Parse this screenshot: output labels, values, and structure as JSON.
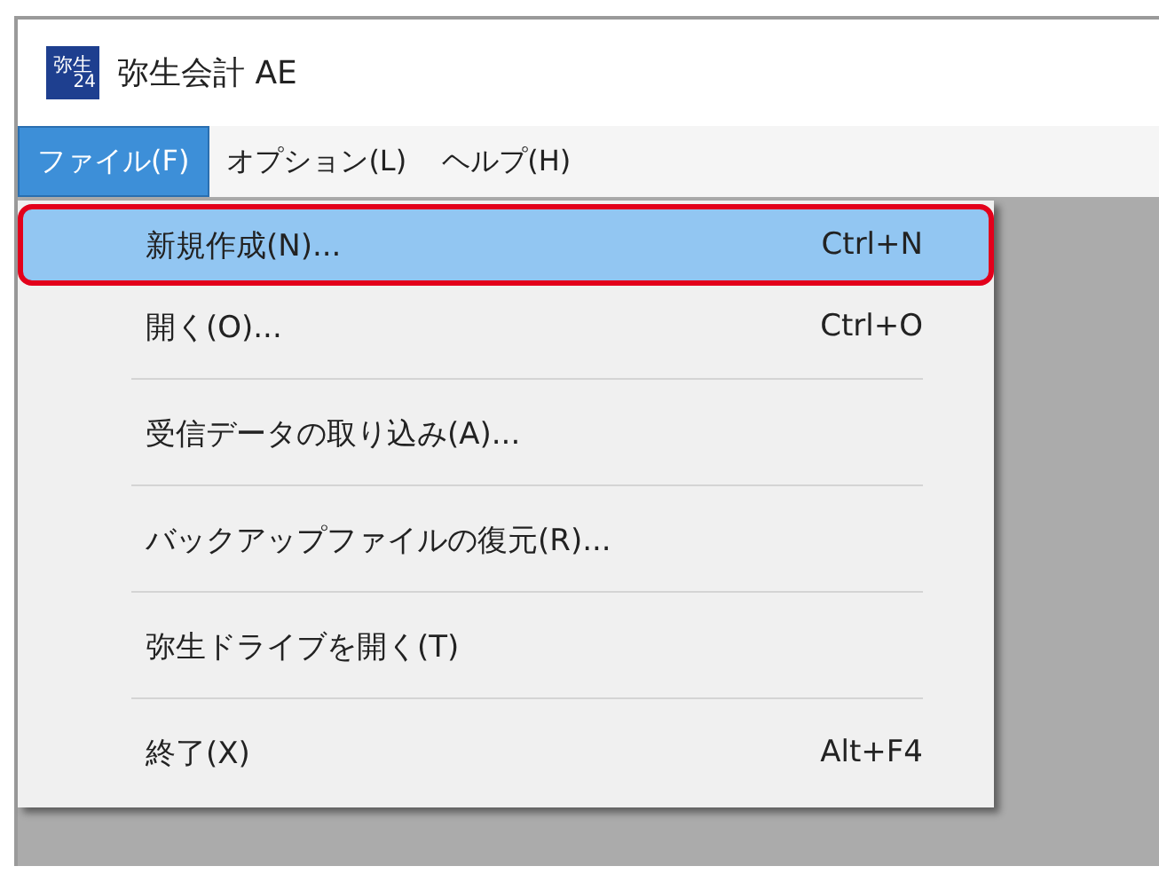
{
  "window": {
    "title": "弥生会計 AE",
    "app_icon": {
      "text": "弥生",
      "subtext": "24"
    }
  },
  "menu_bar": [
    {
      "label": "ファイル(F)",
      "selected": true
    },
    {
      "label": "オプション(L)",
      "selected": false
    },
    {
      "label": "ヘルプ(H)",
      "selected": false
    }
  ],
  "menu": [
    {
      "kind": "item",
      "label": "新規作成(N)...",
      "shortcut": "Ctrl+N",
      "selected": true,
      "outlined": true
    },
    {
      "kind": "item",
      "label": "開く(O)...",
      "shortcut": "Ctrl+O",
      "selected": false,
      "outlined": false
    },
    {
      "kind": "separator"
    },
    {
      "kind": "item",
      "label": "受信データの取り込み(A)...",
      "selected": false,
      "outlined": false
    },
    {
      "kind": "separator"
    },
    {
      "kind": "item",
      "label": "バックアップファイルの復元(R)...",
      "selected": false,
      "outlined": false
    },
    {
      "kind": "separator"
    },
    {
      "kind": "item",
      "label": "弥生ドライブを開く(T)",
      "selected": false,
      "outlined": false
    },
    {
      "kind": "separator"
    },
    {
      "kind": "item",
      "label": "終了(X)",
      "shortcut": "Alt+F4",
      "selected": false,
      "outlined": false
    }
  ]
}
